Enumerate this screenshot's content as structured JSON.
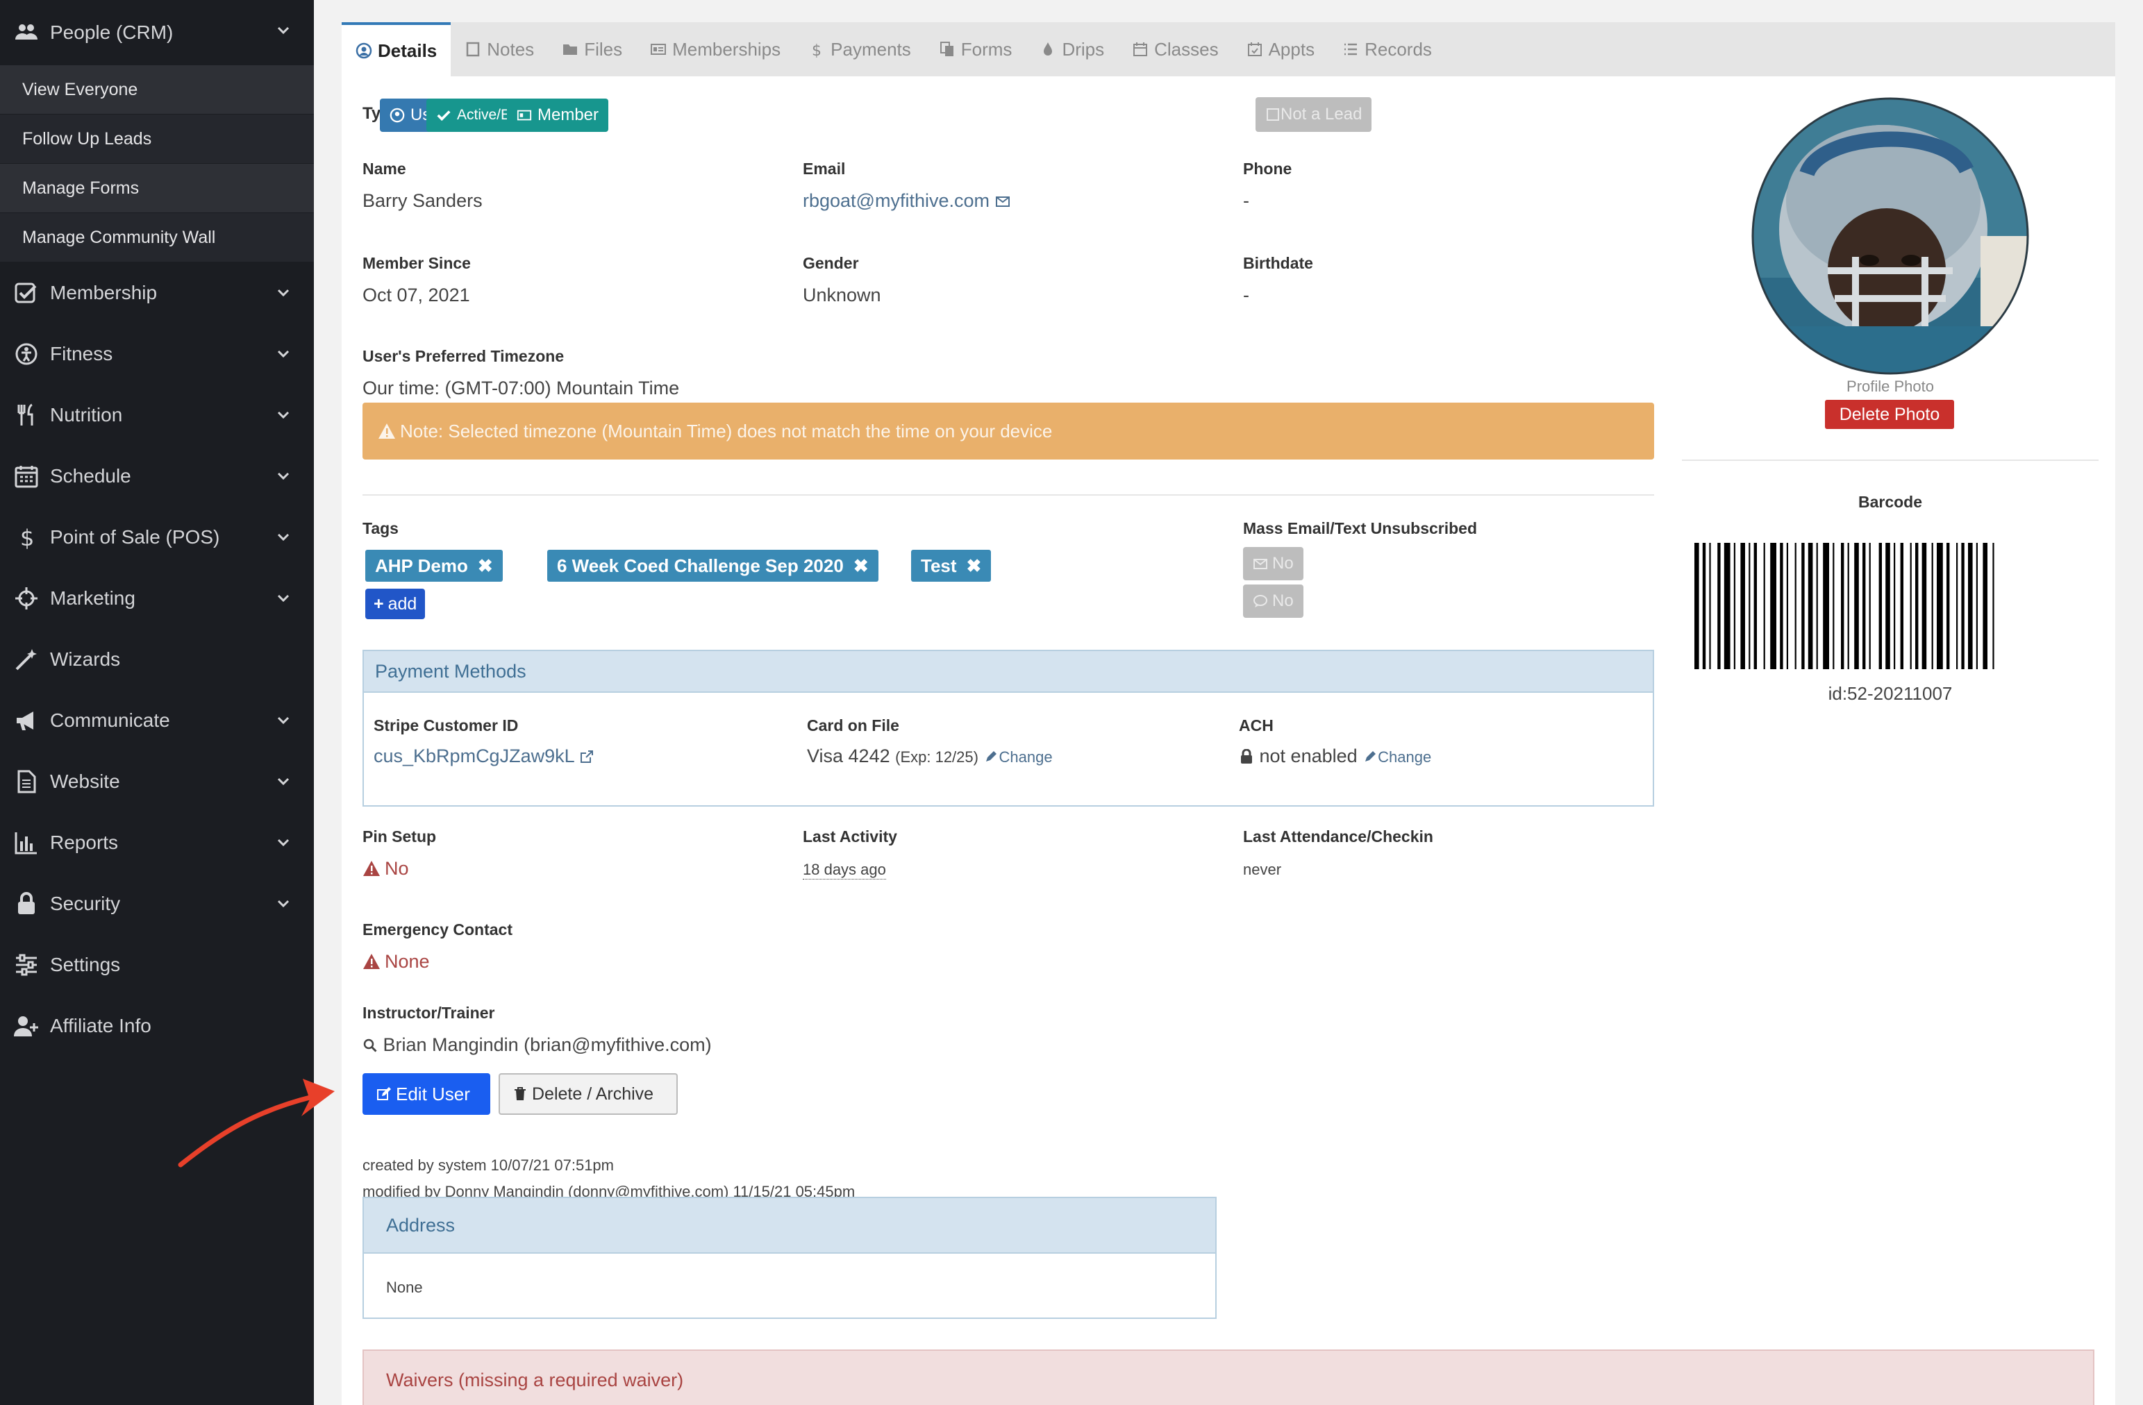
{
  "sidebar": {
    "top": {
      "label": "People (CRM)",
      "icon": "users-icon"
    },
    "sub_items": [
      {
        "label": "View Everyone"
      },
      {
        "label": "Follow Up Leads"
      },
      {
        "label": "Manage Forms"
      },
      {
        "label": "Manage Community Wall"
      }
    ],
    "items": [
      {
        "label": "Membership",
        "icon": "check-square-icon",
        "has_chevron": true
      },
      {
        "label": "Fitness",
        "icon": "fitness-icon",
        "has_chevron": true
      },
      {
        "label": "Nutrition",
        "icon": "utensils-icon",
        "has_chevron": true
      },
      {
        "label": "Schedule",
        "icon": "calendar-icon",
        "has_chevron": true
      },
      {
        "label": "Point of Sale (POS)",
        "icon": "dollar-icon",
        "has_chevron": true
      },
      {
        "label": "Marketing",
        "icon": "crosshair-icon",
        "has_chevron": true
      },
      {
        "label": "Wizards",
        "icon": "magic-wand-icon",
        "has_chevron": false
      },
      {
        "label": "Communicate",
        "icon": "bullhorn-icon",
        "has_chevron": true
      },
      {
        "label": "Website",
        "icon": "document-icon",
        "has_chevron": true
      },
      {
        "label": "Reports",
        "icon": "bar-chart-icon",
        "has_chevron": true
      },
      {
        "label": "Security",
        "icon": "lock-icon",
        "has_chevron": true
      },
      {
        "label": "Settings",
        "icon": "sliders-icon",
        "has_chevron": false
      },
      {
        "label": "Affiliate Info",
        "icon": "user-plus-icon",
        "has_chevron": false
      }
    ]
  },
  "tabs": [
    {
      "label": "Details",
      "icon": "user-circle-icon",
      "active": true
    },
    {
      "label": "Notes",
      "icon": "note-icon"
    },
    {
      "label": "Files",
      "icon": "folder-icon"
    },
    {
      "label": "Memberships",
      "icon": "id-card-icon"
    },
    {
      "label": "Payments",
      "icon": "dollar-icon"
    },
    {
      "label": "Forms",
      "icon": "copy-icon"
    },
    {
      "label": "Drips",
      "icon": "drop-icon"
    },
    {
      "label": "Classes",
      "icon": "calendar-icon"
    },
    {
      "label": "Appts",
      "icon": "calendar-check-icon"
    },
    {
      "label": "Records",
      "icon": "list-icon"
    }
  ],
  "details": {
    "type_label": "Type",
    "badges": {
      "user": "User",
      "active": "Active/Enabled",
      "member": "Member",
      "not_lead": "Not a Lead"
    },
    "name_label": "Name",
    "name_value": "Barry Sanders",
    "email_label": "Email",
    "email_value": "rbgoat@myfithive.com",
    "phone_label": "Phone",
    "phone_value": "-",
    "member_since_label": "Member Since",
    "member_since_value": "Oct 07, 2021",
    "gender_label": "Gender",
    "gender_value": "Unknown",
    "birthdate_label": "Birthdate",
    "birthdate_value": "-",
    "timezone_label": "User's Preferred Timezone",
    "timezone_value": "Our time: (GMT-07:00) Mountain Time",
    "timezone_warning": "Note: Selected timezone (Mountain Time) does not match the time on your device",
    "tags_label": "Tags",
    "tags": [
      "AHP Demo",
      "6 Week Coed Challenge Sep 2020",
      "Test"
    ],
    "add_tag": "add",
    "unsub_label": "Mass Email/Text Unsubscribed",
    "unsub_email": "No",
    "unsub_text": "No"
  },
  "payment_methods": {
    "title": "Payment Methods",
    "stripe_label": "Stripe Customer ID",
    "stripe_value": "cus_KbRpmCgJZaw9kL",
    "card_label": "Card on File",
    "card_value": "Visa 4242",
    "card_exp": "(Exp: 12/25)",
    "card_change": "Change",
    "ach_label": "ACH",
    "ach_value": "not enabled",
    "ach_change": "Change"
  },
  "activity": {
    "pin_label": "Pin Setup",
    "pin_value": "No",
    "last_activity_label": "Last Activity",
    "last_activity_value": "18 days ago",
    "last_attendance_label": "Last Attendance/Checkin",
    "last_attendance_value": "never",
    "emergency_label": "Emergency Contact",
    "emergency_value": "None",
    "instructor_label": "Instructor/Trainer",
    "instructor_value": "Brian Mangindin (brian@myfithive.com)"
  },
  "actions": {
    "edit_user": "Edit User",
    "delete_archive": "Delete / Archive"
  },
  "meta": {
    "created": "created by system 10/07/21 07:51pm",
    "modified": "modified by Donny Mangindin (donny@myfithive.com) 11/15/21 05:45pm"
  },
  "address": {
    "title": "Address",
    "value": "None"
  },
  "waivers": {
    "title": "Waivers (missing a required waiver)"
  },
  "profile": {
    "photo_caption": "Profile Photo",
    "delete_photo": "Delete Photo",
    "barcode_label": "Barcode",
    "barcode_id": "id:52-20211007"
  },
  "colors": {
    "sidebar_bg": "#1b1d22",
    "primary_blue": "#1a5ef0",
    "teal_badge": "#17968e",
    "user_badge": "#3579b0",
    "tag_blue": "#3a8ab5",
    "warning_bg": "#e9b06b",
    "danger": "#c9302c",
    "annotation_arrow": "#e8402a"
  }
}
